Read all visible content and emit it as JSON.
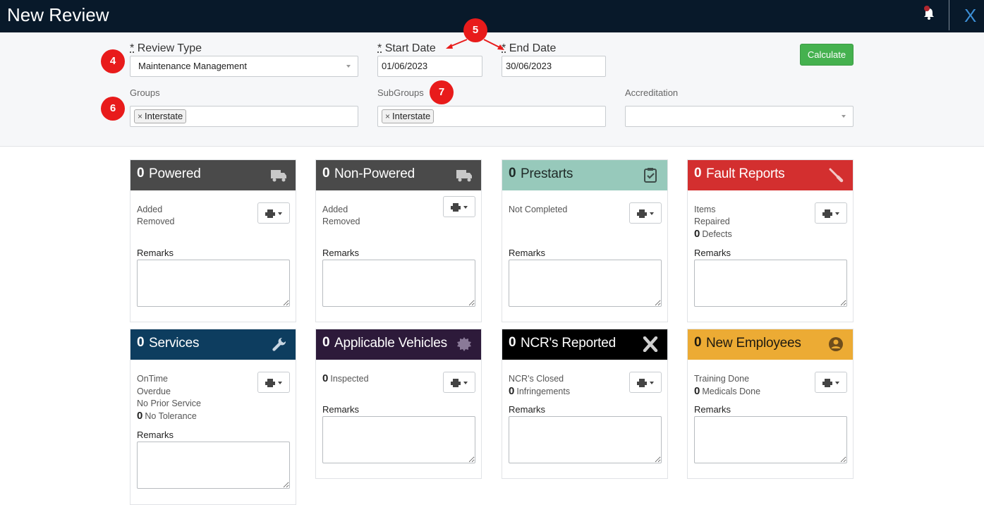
{
  "header": {
    "title": "New Review",
    "close_label": "X"
  },
  "filters": {
    "review_type": {
      "label": "Review Type",
      "required": "*",
      "value": "Maintenance Management"
    },
    "start_date": {
      "label": "Start Date",
      "required": "*",
      "value": "01/06/2023"
    },
    "end_date": {
      "label": "End Date",
      "required": "*",
      "value": "30/06/2023"
    },
    "calculate_label": "Calculate",
    "groups": {
      "label": "Groups",
      "tag": "Interstate",
      "remove": "×"
    },
    "subgroups": {
      "label": "SubGroups",
      "tag": "Interstate",
      "remove": "×"
    },
    "accreditation": {
      "label": "Accreditation",
      "value": ""
    }
  },
  "annotations": {
    "review_type": "4",
    "dates": "5",
    "groups": "6",
    "subgroups": "7"
  },
  "cards": {
    "powered": {
      "count": "0",
      "title": "Powered",
      "color": "#4a4a4a",
      "icon": "truck-icon",
      "stats": [
        "Added",
        "Removed"
      ],
      "remarks": "Remarks"
    },
    "non_powered": {
      "count": "0",
      "title": "Non-Powered",
      "color": "#4a4a4a",
      "icon": "truck-icon",
      "stats": [
        "Added",
        "Removed"
      ],
      "remarks": "Remarks"
    },
    "prestarts": {
      "count": "0",
      "title": "Prestarts",
      "color": "#97c9bb",
      "icon": "clipboard-check-icon",
      "stats": [
        "Not Completed"
      ],
      "remarks": "Remarks"
    },
    "fault_reports": {
      "count": "0",
      "title": "Fault Reports",
      "color": "#d32f2f",
      "icon": "screwdriver-icon",
      "stats": [
        "Items",
        "Repaired"
      ],
      "defects_count": "0",
      "defects_label": "Defects",
      "remarks": "Remarks"
    },
    "services": {
      "count": "0",
      "title": "Services",
      "color": "#0d3d5f",
      "icon": "wrench-icon",
      "stats": [
        "OnTime",
        "Overdue",
        "No Prior Service"
      ],
      "no_tolerance_count": "0",
      "no_tolerance_label": "No Tolerance",
      "remarks": "Remarks"
    },
    "applicable_vehicles": {
      "count": "0",
      "title": "Applicable Vehicles",
      "color": "#2d1a3a",
      "icon": "gear-badge-icon",
      "inspected_count": "0",
      "inspected_label": "Inspected",
      "remarks": "Remarks"
    },
    "ncrs": {
      "count": "0",
      "title": "NCR's Reported",
      "color": "#000000",
      "icon": "x-mark-icon",
      "stats": [
        "NCR's Closed"
      ],
      "infringements_count": "0",
      "infringements_label": "Infringements",
      "remarks": "Remarks"
    },
    "new_employees": {
      "count": "0",
      "title": "New Employees",
      "color": "#ecab34",
      "icon": "user-circle-icon",
      "stats": [
        "Training Done"
      ],
      "medicals_count": "0",
      "medicals_label": "Medicals Done",
      "remarks": "Remarks"
    }
  }
}
